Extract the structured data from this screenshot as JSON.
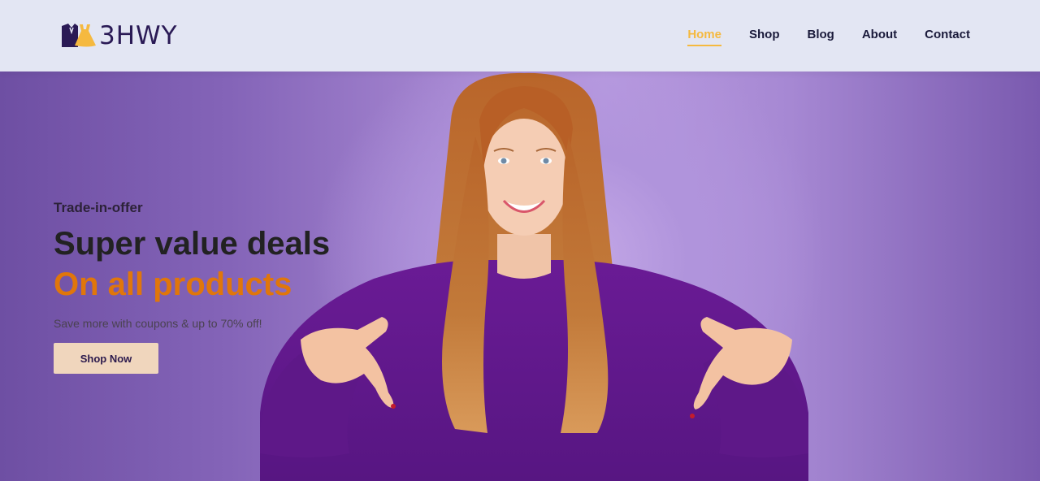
{
  "header": {
    "logo_text": "3HWY",
    "nav": [
      {
        "label": "Home",
        "active": true
      },
      {
        "label": "Shop",
        "active": false
      },
      {
        "label": "Blog",
        "active": false
      },
      {
        "label": "About",
        "active": false
      },
      {
        "label": "Contact",
        "active": false
      }
    ]
  },
  "hero": {
    "kicker": "Trade-in-offer",
    "headline": "Super value deals",
    "headline_accent": "On all products",
    "subtext": "Save more with coupons & up to 70% off!",
    "cta_label": "Shop Now",
    "image": "smiling-woman-pointing-down"
  },
  "colors": {
    "header_bg": "#e3e6f3",
    "accent_yellow": "#f5b93f",
    "accent_orange": "#e0760b",
    "button_bg": "#f0d6bd",
    "hero_purple": "#8a6bbf"
  }
}
